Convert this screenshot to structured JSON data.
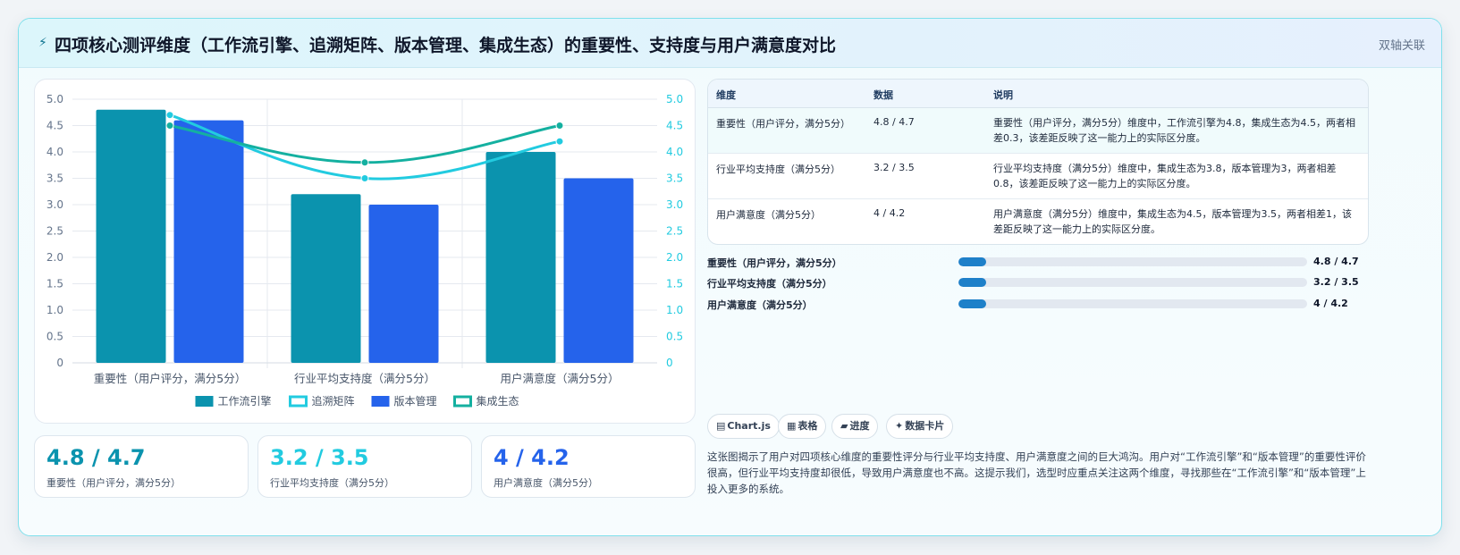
{
  "header": {
    "icon": "lightning-icon",
    "title": "四项核心测评维度（工作流引擎、追溯矩阵、版本管理、集成生态）的重要性、支持度与用户满意度对比",
    "badge": "双轴关联"
  },
  "colors": {
    "工作流引擎": "#0b93ae",
    "追溯矩阵": "#22cbe0",
    "版本管理": "#2563eb",
    "集成生态": "#14b0a0",
    "progress": "#1e80c9"
  },
  "chart_data": {
    "type": "bar",
    "categories": [
      "重要性（用户评分，满分5分）",
      "行业平均支持度（满分5分）",
      "用户满意度（满分5分）"
    ],
    "series": [
      {
        "name": "工作流引擎",
        "type": "bar",
        "values": [
          4.8,
          3.2,
          4.0
        ],
        "color": "#0b93ae"
      },
      {
        "name": "版本管理",
        "type": "bar",
        "values": [
          4.6,
          3.0,
          3.5
        ],
        "color": "#2563eb"
      },
      {
        "name": "追溯矩阵",
        "type": "line",
        "axis": "right",
        "values": [
          4.7,
          3.5,
          4.2
        ],
        "color": "#22cbe0"
      },
      {
        "name": "集成生态",
        "type": "line",
        "axis": "right",
        "values": [
          4.5,
          3.8,
          4.5
        ],
        "color": "#14b0a0"
      }
    ],
    "ylim": [
      0,
      5
    ],
    "yticks": [
      "0",
      "0.5",
      "1.0",
      "1.5",
      "2.0",
      "2.5",
      "3.0",
      "3.5",
      "4.0",
      "4.5",
      "5.0"
    ],
    "y2lim": [
      0,
      5
    ],
    "y2ticks": [
      "0",
      "0.5",
      "1.0",
      "1.5",
      "2.0",
      "2.5",
      "3.0",
      "3.5",
      "4.0",
      "4.5",
      "5.0"
    ],
    "legend_position": "bottom",
    "legend": [
      "工作流引擎",
      "追溯矩阵",
      "版本管理",
      "集成生态"
    ]
  },
  "kpis": [
    {
      "value": "4.8 / 4.7",
      "label": "重要性（用户评分，满分5分）",
      "color": "#0b93ae"
    },
    {
      "value": "3.2 / 3.5",
      "label": "行业平均支持度（满分5分）",
      "color": "#22cbe0"
    },
    {
      "value": "4 / 4.2",
      "label": "用户满意度（满分5分）",
      "color": "#2563eb"
    }
  ],
  "table": {
    "headers": [
      "维度",
      "数据",
      "说明"
    ],
    "rows": [
      {
        "dim": "重要性（用户评分，满分5分）",
        "data": "4.8 / 4.7",
        "note": "重要性（用户评分，满分5分）维度中，工作流引擎为4.8，集成生态为4.5，两者相差0.3，该差距反映了这一能力上的实际区分度。"
      },
      {
        "dim": "行业平均支持度（满分5分）",
        "data": "3.2 / 3.5",
        "note": "行业平均支持度（满分5分）维度中，集成生态为3.8，版本管理为3，两者相差0.8，该差距反映了这一能力上的实际区分度。"
      },
      {
        "dim": "用户满意度（满分5分）",
        "data": "4 / 4.2",
        "note": "用户满意度（满分5分）维度中，集成生态为4.5，版本管理为3.5，两者相差1，该差距反映了这一能力上的实际区分度。"
      }
    ]
  },
  "progress": [
    {
      "label": "重要性（用户评分，满分5分）",
      "value": "4.8 / 4.7",
      "fraction": 0.08
    },
    {
      "label": "行业平均支持度（满分5分）",
      "value": "3.2 / 3.5",
      "fraction": 0.08
    },
    {
      "label": "用户满意度（满分5分）",
      "value": "4 / 4.2",
      "fraction": 0.08
    }
  ],
  "chips": [
    {
      "icon": "chart-icon",
      "glyph": "▤",
      "label": "Chart.js"
    },
    {
      "icon": "table-icon",
      "glyph": "▦",
      "label": "表格"
    },
    {
      "icon": "progress-icon",
      "glyph": "▰",
      "label": "进度"
    },
    {
      "icon": "sparkle-icon",
      "glyph": "✦",
      "label": "数据卡片"
    }
  ],
  "summary": "这张图揭示了用户对四项核心维度的重要性评分与行业平均支持度、用户满意度之间的巨大鸿沟。用户对“工作流引擎”和“版本管理”的重要性评价很高，但行业平均支持度却很低，导致用户满意度也不高。这提示我们，选型时应重点关注这两个维度，寻找那些在“工作流引擎”和“版本管理”上投入更多的系统。"
}
